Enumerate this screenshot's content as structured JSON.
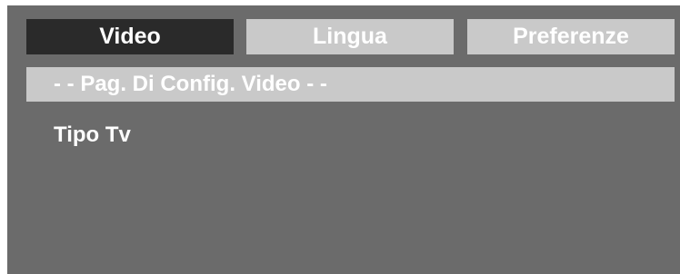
{
  "tabs": [
    {
      "label": "Video",
      "active": true
    },
    {
      "label": "Lingua",
      "active": false
    },
    {
      "label": "Preferenze",
      "active": false
    }
  ],
  "section_header": "- - Pag. Di Config. Video - -",
  "menu_items": [
    {
      "label": "Tipo Tv"
    }
  ],
  "colors": {
    "background": "#6b6b6b",
    "active_tab": "#2a2a2a",
    "inactive_tab": "#c9c9c9",
    "text": "#ffffff"
  }
}
